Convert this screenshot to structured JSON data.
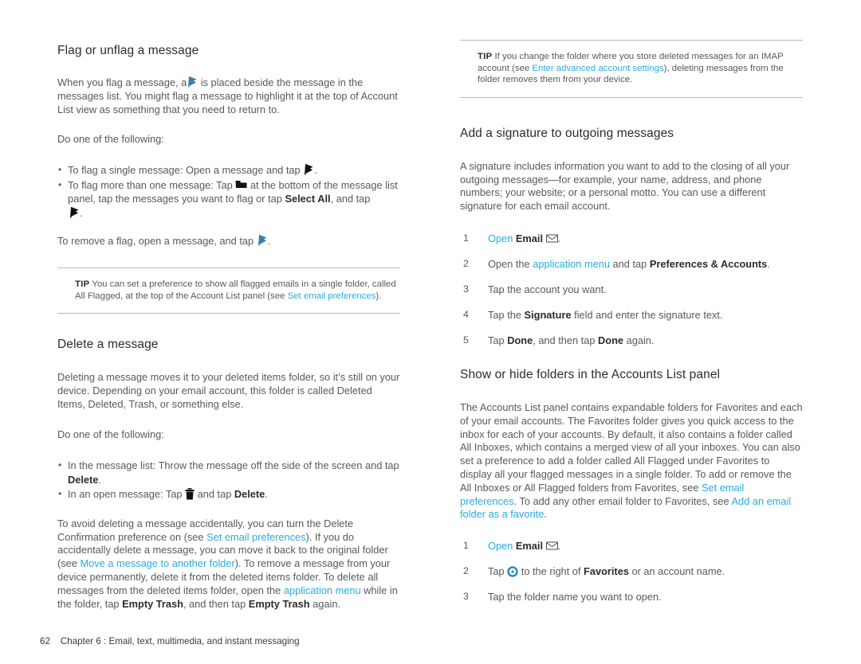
{
  "document": {
    "footer": {
      "page_number": "62",
      "chapter_text": "Chapter 6 :  Email, text, multimedia, and instant messaging"
    }
  },
  "left_column": {
    "flag_section": {
      "title": "Flag or unflag a message",
      "intro_1": "When you flag a message, a",
      "intro_2": "is placed beside the message in the messages list. You might flag a message to highlight it at the top of Account List view as something that you need to return to.",
      "do_one": "Do one of the following:",
      "bullet1_a": "To flag a single message: Open a message and tap",
      "bullet1_b": ".",
      "bullet2_a": "To flag more than one message: Tap",
      "bullet2_b": "at the bottom of the message list panel, tap the messages you want to flag or tap",
      "bullet2_bold": "Select All",
      "bullet2_c": ", and tap",
      "bullet2_d": ".",
      "remove_a": "To remove a flag, open a message, and tap",
      "remove_b": ".",
      "tip_word": "TIP",
      "tip_a": "You can set a preference to show all flagged emails in a single folder, called All Flagged, at the top of the Account List panel (see",
      "tip_link": "Set email preferences",
      "tip_b": ")."
    },
    "delete_section": {
      "title": "Delete a message",
      "para_1": "Deleting a message moves it to your deleted items folder, so it’s still on your device. Depending on your email account, this folder is called Deleted Items, Deleted, Trash, or something else.",
      "do_one": "Do one of the following:",
      "bullet1_a": "In the message list: Throw the message off the side of the screen and tap",
      "bullet1_bold": "Delete",
      "bullet1_b": ".",
      "bullet2_a": "In an open message: Tap",
      "bullet2_b": "and tap",
      "bullet2_bold": "Delete",
      "bullet2_c": ".",
      "para_2_a": "To avoid deleting a message accidentally, you can turn the Delete Confirmation preference on (see",
      "para_2_link1": "Set email preferences",
      "para_2_b": "). If you do accidentally delete a message, you can move it back to the original folder (see",
      "para_2_link2": "Move a message to another folder",
      "para_2_c": "). To remove a message from your device permanently, delete it from the deleted items folder. To delete all messages from the deleted items folder, open the",
      "para_2_link3": "application menu",
      "para_2_d": "while in the folder, tap",
      "para_2_bold1": "Empty Trash",
      "para_2_e": ", and then tap",
      "para_2_bold2": "Empty Trash",
      "para_2_f": "again."
    }
  },
  "right_column": {
    "tip_top": {
      "tip_word": "TIP",
      "text_a": "If you change the folder where you store deleted messages for an IMAP account (see",
      "link": "Enter advanced account settings",
      "text_b": "), deleting messages from the folder removes them from your device."
    },
    "signature_section": {
      "title": "Add a signature to outgoing messages",
      "para": "A signature includes information you want to add to the closing of all your outgoing messages—for example, your name, address, and phone numbers; your website; or a personal motto. You can use a different signature for each email account.",
      "steps": [
        {
          "link": "Open",
          "bold": "Email",
          "after": "."
        },
        {
          "before": "Open the",
          "link": "application menu",
          "mid": "and tap",
          "bold": "Preferences & Accounts",
          "after": "."
        },
        {
          "plain": "Tap the account you want."
        },
        {
          "before": "Tap the",
          "bold": "Signature",
          "after": "field and enter the signature text."
        },
        {
          "before": "Tap",
          "bold": "Done",
          "mid": ", and then tap",
          "bold2": "Done",
          "after": "again."
        }
      ]
    },
    "folders_section": {
      "title": "Show or hide folders in the Accounts List panel",
      "para_a": "The Accounts List panel contains expandable folders for Favorites and each of your email accounts. The Favorites folder gives you quick access to the inbox for each of your accounts. By default, it also contains a folder called All Inboxes, which contains a merged view of all your inboxes. You can also set a preference to add a folder called All Flagged under Favorites to display all your flagged messages in a single folder. To add or remove the All Inboxes or All Flagged folders from Favorites, see",
      "link1": "Set email preferences",
      "para_b": ". To add any other email folder to Favorites, see",
      "link2": "Add an email folder as a favorite",
      "para_c": ".",
      "steps": [
        {
          "link": "Open",
          "bold": "Email",
          "after": "."
        },
        {
          "before": "Tap",
          "mid": "to the right of",
          "bold": "Favorites",
          "after": "or an account name."
        },
        {
          "plain": "Tap the folder name you want to open."
        }
      ]
    }
  },
  "icons": {
    "flag_blue": "flag-blue-icon",
    "flag_black": "flag-black-icon",
    "folder": "folder-icon",
    "trash": "trash-icon",
    "envelope": "envelope-icon",
    "play_expand": "play-expand-icon"
  },
  "colors": {
    "link": "#29abe2",
    "body_text": "#58595b",
    "heading": "#2c2c2c",
    "rule": "#b9babc",
    "flag_blue": "#3b7ea8",
    "play_blue": "#2d8fd0"
  }
}
